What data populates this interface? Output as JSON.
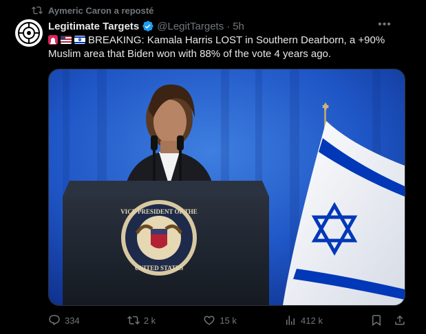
{
  "repost": {
    "label": "Aymeric Caron a reposté",
    "icon": "repost-icon"
  },
  "tweet": {
    "author_name": "Legitimate Targets",
    "verified": true,
    "handle": "@LegitTargets",
    "separator": "·",
    "time": "5h",
    "flags": [
      "alarm-emoji",
      "us-flag-emoji",
      "israel-flag-emoji"
    ],
    "text": "BREAKING: Kamala Harris LOST in Southern Dearborn, a +90% Muslim area that Biden won with 88% of the vote 4 years ago.",
    "image": {
      "seal_text": "VICE PRESIDENT OF THE UNITED STATES",
      "description_icons": [
        "podium",
        "microphones",
        "israeli-flag"
      ]
    }
  },
  "actions": {
    "reply": "334",
    "retweet": "2 k",
    "like": "15 k",
    "views": "412 k"
  },
  "colors": {
    "background": "#000000",
    "text": "#e7e9ea",
    "muted": "#71767b",
    "verified": "#1d9bf0",
    "flag_blue": "#0038b8"
  }
}
